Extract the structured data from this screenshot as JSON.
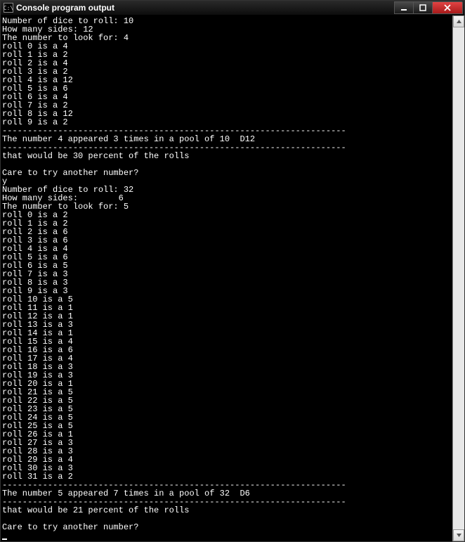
{
  "window": {
    "title": "Console program output",
    "icon_label": "C:\\"
  },
  "runs": [
    {
      "num_dice_label": "Number of dice to roll: ",
      "num_dice": 10,
      "sides_label": "How many sides: ",
      "sides_pad": "",
      "sides": 12,
      "lookfor_label": "The number to look for: ",
      "lookfor": 4,
      "rolls": [
        4,
        2,
        4,
        2,
        12,
        6,
        4,
        2,
        12,
        2
      ],
      "summary_before": "The number ",
      "summary_num": 4,
      "summary_mid1": " appeared ",
      "summary_count": 3,
      "summary_mid2": " times in a pool of ",
      "summary_pool": 10,
      "summary_die": "  D12",
      "percent_before": "that would be ",
      "percent": 30,
      "percent_after": " percent of the rolls",
      "prompt": "Care to try another number?",
      "answer": "y"
    },
    {
      "num_dice_label": "Number of dice to roll: ",
      "num_dice": 32,
      "sides_label": "How many sides:        ",
      "sides_pad": "",
      "sides": 6,
      "lookfor_label": "The number to look for: ",
      "lookfor": 5,
      "rolls": [
        2,
        2,
        6,
        6,
        4,
        6,
        5,
        3,
        3,
        3,
        5,
        1,
        1,
        3,
        1,
        4,
        6,
        4,
        3,
        3,
        1,
        5,
        5,
        5,
        5,
        5,
        1,
        3,
        3,
        4,
        3,
        2
      ],
      "summary_before": "The number ",
      "summary_num": 5,
      "summary_mid1": " appeared ",
      "summary_count": 7,
      "summary_mid2": " times in a pool of ",
      "summary_pool": 32,
      "summary_die": "  D6",
      "percent_before": "that would be ",
      "percent": 21,
      "percent_after": " percent of the rolls",
      "prompt": "Care to try another number?",
      "answer": ""
    }
  ],
  "sep": "--------------------------------------------------------------------"
}
